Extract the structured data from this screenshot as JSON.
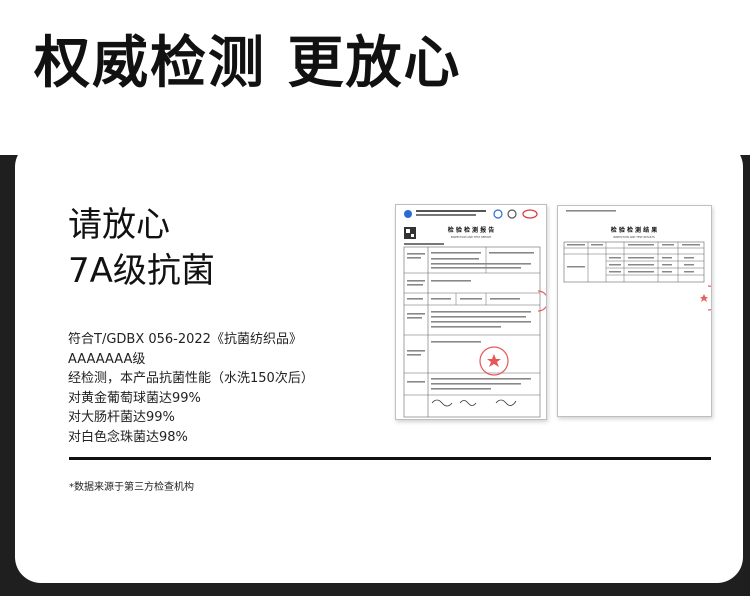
{
  "headline": "权威检测 更放心",
  "card": {
    "title_line1": "请放心",
    "title_line2": "7A级抗菌",
    "description": [
      "符合T/GDBX 056-2022《抗菌纺织品》",
      "AAAAAAA级",
      "经检测，本产品抗菌性能（水洗150次后）",
      "对黄金葡萄球菌达99%",
      "对大肠杆菌达99%",
      "对白色念珠菌达98%"
    ],
    "footnote": "*数据来源于第三方检查机构"
  },
  "report1": {
    "title": "检 验 检 测 报 告",
    "subtitle": "INSPECTION AND TEST REPORT"
  },
  "report2": {
    "title": "检 验 检 测 结 果",
    "subtitle": "INSPECTION AND TEST RESULTS"
  },
  "colors": {
    "background": "#1f1f1f",
    "card": "#ffffff",
    "text": "#111111",
    "stamp": "#e23a3a"
  }
}
